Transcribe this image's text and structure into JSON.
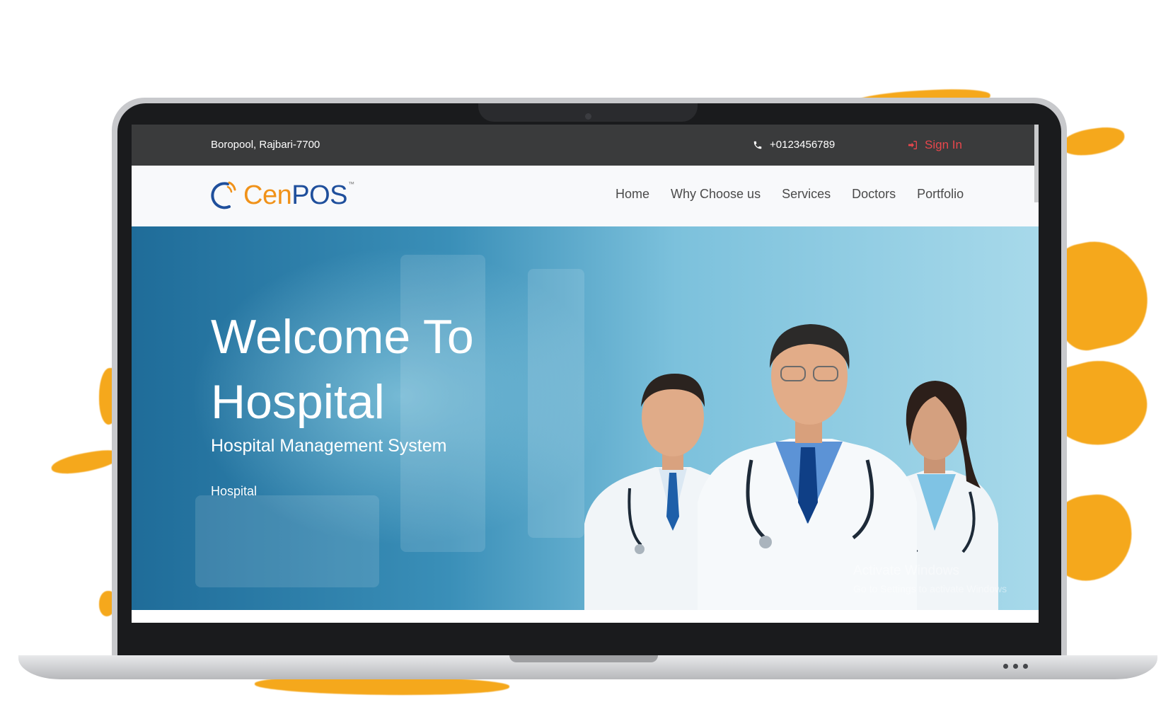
{
  "topbar": {
    "address": "Boropool, Rajbari-7700",
    "phone": "+0123456789",
    "sign_in": "Sign In"
  },
  "brand": {
    "name_part1": "Cen",
    "name_part2": "POS",
    "trademark": "™"
  },
  "nav": {
    "items": [
      {
        "label": "Home"
      },
      {
        "label": "Why Choose us"
      },
      {
        "label": "Services"
      },
      {
        "label": "Doctors"
      },
      {
        "label": "Portfolio"
      }
    ]
  },
  "hero": {
    "title_line1": "Welcome To",
    "title_line2": "Hospital",
    "subtitle": "Hospital Management System",
    "tag": "Hospital"
  },
  "watermark": {
    "line1": "Activate Windows",
    "line2": "Go to Settings to activate Windows"
  },
  "colors": {
    "accent_orange": "#f5a81c",
    "signin_red": "#e8474c",
    "topbar_bg": "#3a3b3c",
    "logo_orange": "#f0921a",
    "logo_blue": "#1f4f9c"
  }
}
